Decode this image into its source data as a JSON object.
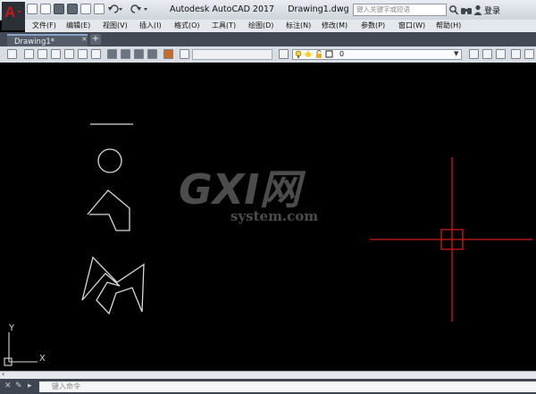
{
  "app": {
    "title": "Autodesk AutoCAD 2017",
    "file": "Drawing1.dwg",
    "logo_letter": "A"
  },
  "search": {
    "placeholder": "键入关键字或短语"
  },
  "account": {
    "login_label": "登录"
  },
  "menus": [
    "文件(F)",
    "编辑(E)",
    "视图(V)",
    "插入(I)",
    "格式(O)",
    "工具(T)",
    "绘图(D)",
    "标注(N)",
    "修改(M)",
    "参数(P)",
    "窗口(W)",
    "帮助(H)"
  ],
  "tabs": [
    {
      "label": "Drawing1*",
      "close": "×"
    }
  ],
  "tab_add": "+",
  "layer": {
    "current": "0"
  },
  "ucs": {
    "x_label": "X",
    "y_label": "Y"
  },
  "watermark": {
    "brand": "GXI网",
    "domain": "system.com"
  },
  "command": {
    "placeholder": "键入命令"
  },
  "colors": {
    "crosshair": "#d11a1a",
    "geometry": "#d9d9d9",
    "app_logo": "#c8191e"
  },
  "icons": [
    "app-logo-icon",
    "new-icon",
    "open-icon",
    "save-icon",
    "saveas-icon",
    "print-icon",
    "undo-icon",
    "redo-icon",
    "search-icon",
    "binoculars-icon",
    "user-icon",
    "crosshair-cursor",
    "ucs-icon"
  ]
}
